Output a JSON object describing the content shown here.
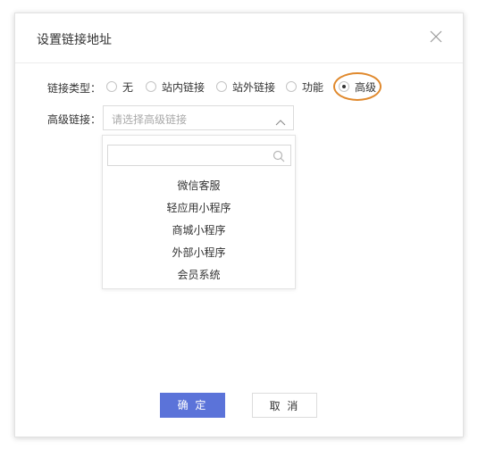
{
  "dialog": {
    "title": "设置链接地址",
    "close_icon": "close-icon"
  },
  "link_type": {
    "label": "链接类型：",
    "options": [
      {
        "label": "无",
        "checked": false
      },
      {
        "label": "站内链接",
        "checked": false
      },
      {
        "label": "站外链接",
        "checked": false
      },
      {
        "label": "功能",
        "checked": false
      },
      {
        "label": "高级",
        "checked": true
      }
    ]
  },
  "advanced_link": {
    "label": "高级链接：",
    "placeholder": "请选择高级链接",
    "arrow_icon": "chevron-up-icon",
    "search_value": "",
    "search_icon": "search-icon",
    "options": [
      "微信客服",
      "轻应用小程序",
      "商城小程序",
      "外部小程序",
      "会员系统"
    ]
  },
  "buttons": {
    "ok": "确 定",
    "cancel": "取 消"
  },
  "colors": {
    "primary": "#5b73d9",
    "highlight": "#e0892d"
  }
}
